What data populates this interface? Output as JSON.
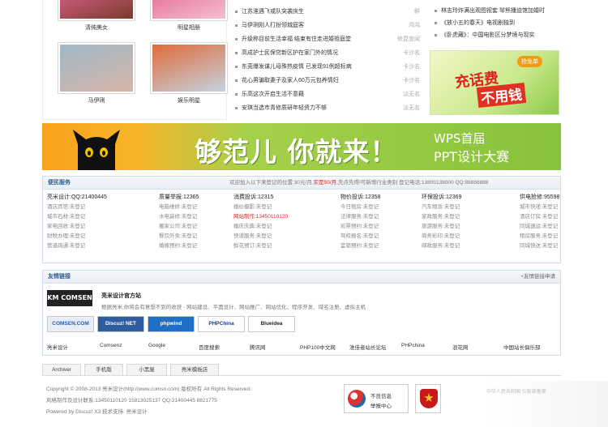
{
  "photos": [
    {
      "caption": "清纯美女",
      "colors": [
        "#c85a7a",
        "#7a3a2a"
      ]
    },
    {
      "caption": "明星相册",
      "colors": [
        "#e97aa0",
        "#f3c0d0"
      ]
    },
    {
      "caption": "马伊琍",
      "colors": [
        "#9fb8c8",
        "#d7b5a8"
      ]
    },
    {
      "caption": "娱乐明星",
      "colors": [
        "#e06b3a",
        "#c5d3e0"
      ]
    }
  ],
  "news": [
    {
      "text": "江苏淮遇飞或队突袭庆生",
      "who": "鲜"
    },
    {
      "text": "马伊琍刚人打扮领城庭客",
      "who": "鸿鸿"
    },
    {
      "text": "升级称目前生活幸福 结束有住走进婚祖庭堂",
      "who": "修昆宣闻"
    },
    {
      "text": "高成护士民保贷新区护在家门外的情况",
      "who": "卡沙名"
    },
    {
      "text": "东莞爆发谋儿母殊热疫情 已发现91例超标病",
      "who": "卡沙名"
    },
    {
      "text": "花心男骗取妻子及家人60万元包养情妇",
      "who": "卡沙名"
    },
    {
      "text": "乐高这次开启生活不意藉",
      "who": "淡无名"
    },
    {
      "text": "安琪当选市青修质研年轻资力不够",
      "who": "淡无名"
    }
  ],
  "right_news": [
    "林志玲炸满出观图视套 琴熊播迫馆加婚时",
    "《放小五的春天》电视剧独到",
    "《卧虎藏》：中国电影区分梦境与现实"
  ],
  "phone_ad": {
    "line1": "充话费",
    "line2": "不用钱",
    "tag": "抢免单"
  },
  "banner": {
    "main": "够范儿 你就来！",
    "sub1": "WPS首届",
    "sub2": "PPT设计大赛"
  },
  "service": {
    "title": "便民服务",
    "notice_prefix": "欢迎加入以下来登记的位置:30元/月,",
    "notice_red": "实是50/月,",
    "notice_suffix": "先点先得!可新增行业类别 登记电话:13800138000 QQ:88888888",
    "columns": [
      {
        "head": "亮米设计:QQ:21400445",
        "items": [
          "酒店宾馆:未登记",
          "城市石材:未登记",
          "家电回收:未登记",
          "财税办理:未登记",
          "管道疏通:未登记"
        ]
      },
      {
        "head": "质量举报:12365",
        "items": [
          "电脑维修:未登记",
          "水电装修:未登记",
          "搬家公司:未登记",
          "餐饮外卖:未登记",
          "婚嫁预约:未登记"
        ]
      },
      {
        "head": "消费投诉:12315",
        "items": [
          "婚纱摄影:未登记",
          "网站制作:13450110120",
          "婚庆庆典:未登记",
          "快递服务:未登记",
          "鲜花预订:未登记"
        ],
        "red_index": 1
      },
      {
        "head": "物价投诉:12358",
        "items": [
          "今日租房:未登记",
          "法律服务:未登记",
          "彩票预约:未登记",
          "驾校报名:未登记",
          "篮锁预约:未登记"
        ]
      },
      {
        "head": "环保投诉:12369",
        "items": [
          "汽车租赁:未登记",
          "家政服务:未登记",
          "旅游服务:未登记",
          "商务彩印:未登记",
          "邮政服务:未登记"
        ]
      },
      {
        "head": "供电抢修:95598",
        "items": [
          "城市快递:未登记",
          "酒店订房:未登记",
          "同城速运:未登记",
          "租房服务:未登记",
          "同城快送:未登记"
        ]
      }
    ]
  },
  "links": {
    "title": "友情链接",
    "more": "+友情链接申请",
    "featured_logo": "KM COMSEN",
    "featured_name": "亮米设计官方站",
    "featured_desc": "根据亮米,你将会有意想不到的收获 - 网站建设、平面设计、网站推广、网站优化、程序开发、域名注册、虚拟主机",
    "logos": [
      {
        "text": "COMSEN.COM",
        "bg": "#e8eef8",
        "color": "#2a5ea8"
      },
      {
        "text": "Discuz! NET",
        "bg": "#2d5d9f",
        "color": "#ffffff"
      },
      {
        "text": "phpwind",
        "bg": "#1f6fc6",
        "color": "#ffffff"
      },
      {
        "text": "PHPChina",
        "bg": "#ffffff",
        "color": "#1a3d7c"
      },
      {
        "text": "Blueidea",
        "bg": "#ffffff",
        "color": "#222222"
      }
    ],
    "text_links": [
      "亮米设计",
      "Comsenz",
      "Google",
      "百度搜索",
      "腾讯网",
      "PHP100中文网",
      "淮佳者站长论坛",
      "PHPchina",
      "浪花网",
      "中国站长俱乐部"
    ]
  },
  "footer": {
    "tabs": [
      "Archiver",
      "手机版",
      "小黑屋",
      "亮米模板店"
    ],
    "line1": "Copyright © 2008-2013 亮米设计(http://www.comsn.com) 版权所有 All Rights Reserved.",
    "line2": "风格制作及设计联系:13450110120 15813025137 QQ:21400445 8821775",
    "line3": "Powered by Discuz! X3  技术支持: 亮米设计",
    "cert1_line1": "不良信息",
    "cert1_line2": "举报中心",
    "side_text": "中华人民共和国 公安部备案"
  }
}
